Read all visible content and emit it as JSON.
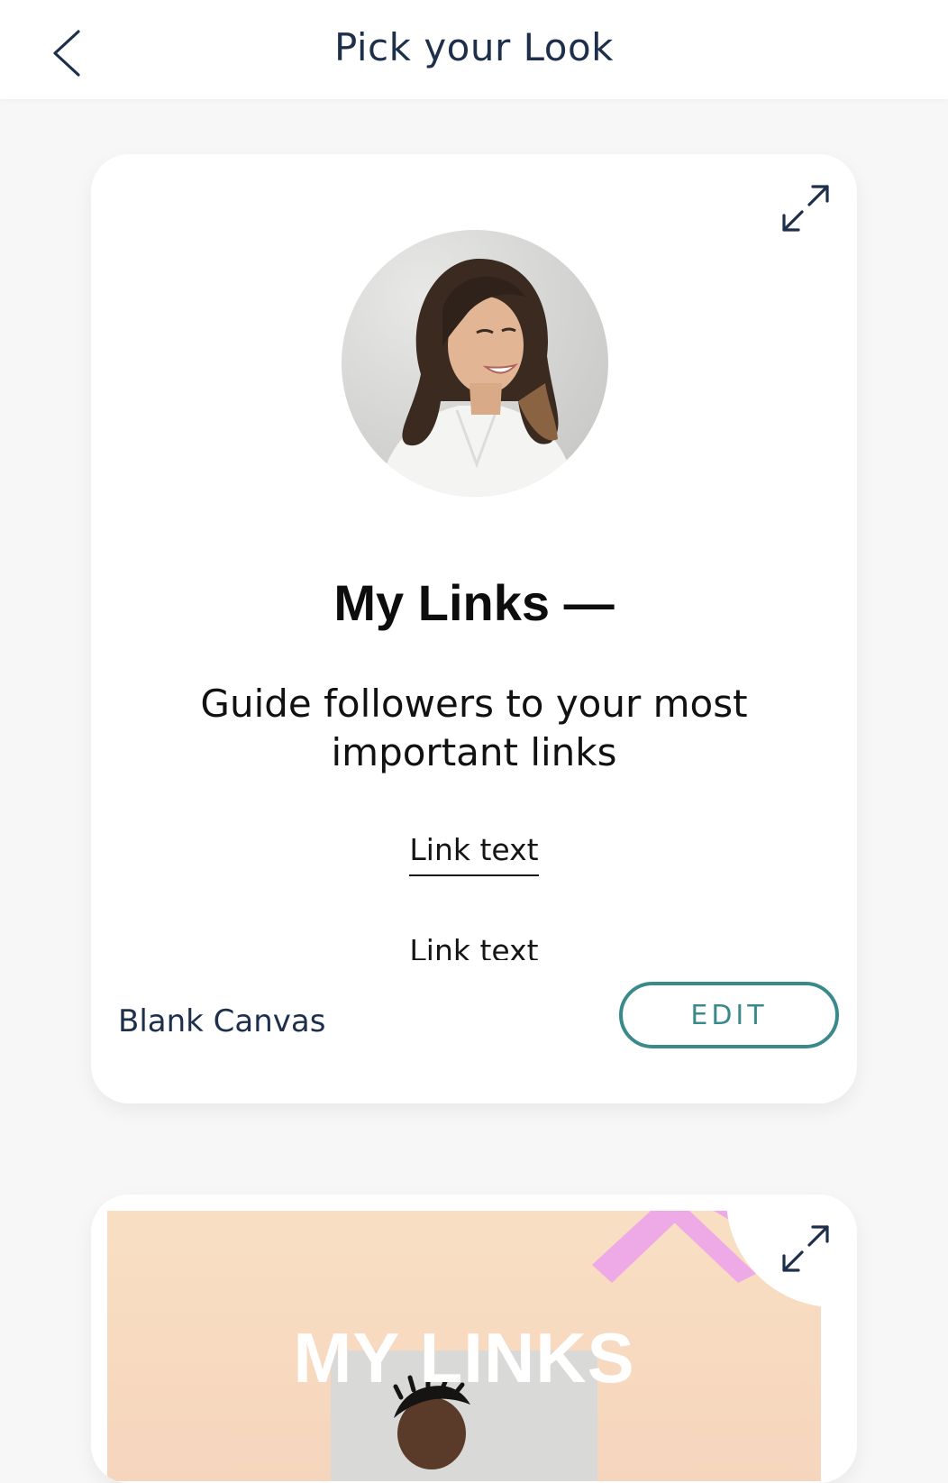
{
  "header": {
    "title": "Pick your Look",
    "back_icon": "chevron-left-icon"
  },
  "templates": [
    {
      "name": "Blank Canvas",
      "edit_label": "EDIT",
      "expand_icon": "expand-arrows-icon",
      "preview": {
        "title": "My Links —",
        "description": "Guide followers to your most important links",
        "links": [
          "Link text",
          "Link text"
        ]
      }
    },
    {
      "expand_icon": "expand-arrows-icon",
      "preview": {
        "title": "MY LINKS"
      }
    }
  ],
  "colors": {
    "navy": "#1d2f4b",
    "teal": "#3a8a8c",
    "peach": "#f8dfc3",
    "pink": "#eeaae6"
  }
}
